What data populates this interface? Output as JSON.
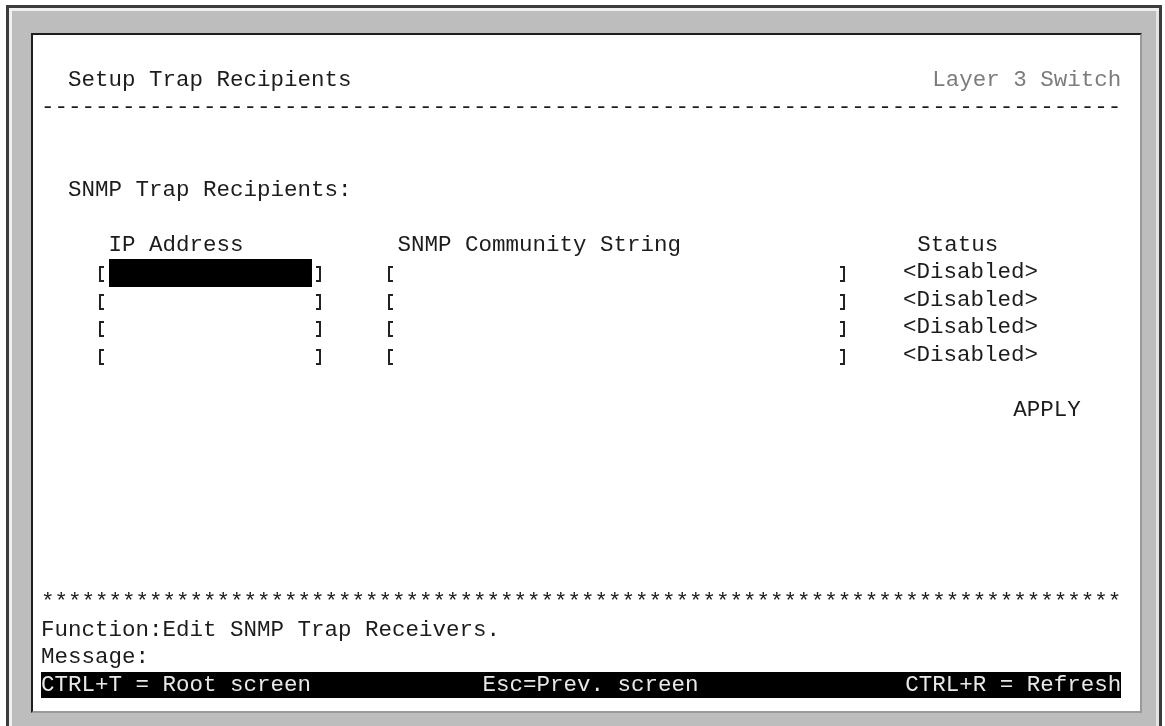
{
  "header": {
    "title": "Setup Trap Recipients",
    "device": "Layer 3 Switch",
    "rule": "--------------------------------------------------------------------------------"
  },
  "section_label": "SNMP Trap Recipients:",
  "columns": [
    "IP Address",
    "SNMP Community String",
    "Status"
  ],
  "rows": [
    {
      "ip_address_field": {
        "selected": true
      },
      "community_string_field": {
        "selected": false
      },
      "status": "<Disabled>"
    },
    {
      "ip_address_field": {
        "selected": false
      },
      "community_string_field": {
        "selected": false
      },
      "status": "<Disabled>"
    },
    {
      "ip_address_field": {
        "selected": false
      },
      "community_string_field": {
        "selected": false
      },
      "status": "<Disabled>"
    },
    {
      "ip_address_field": {
        "selected": false
      },
      "community_string_field": {
        "selected": false
      },
      "status": "<Disabled>"
    }
  ],
  "apply_button": "APPLY",
  "footer": {
    "rule": "********************************************************************************",
    "function": "Function:Edit SNMP Trap Receivers.",
    "message": "Message:"
  },
  "shortcuts": [
    "CTRL+T = Root screen",
    "Esc=Prev. screen",
    "CTRL+R = Refresh"
  ]
}
